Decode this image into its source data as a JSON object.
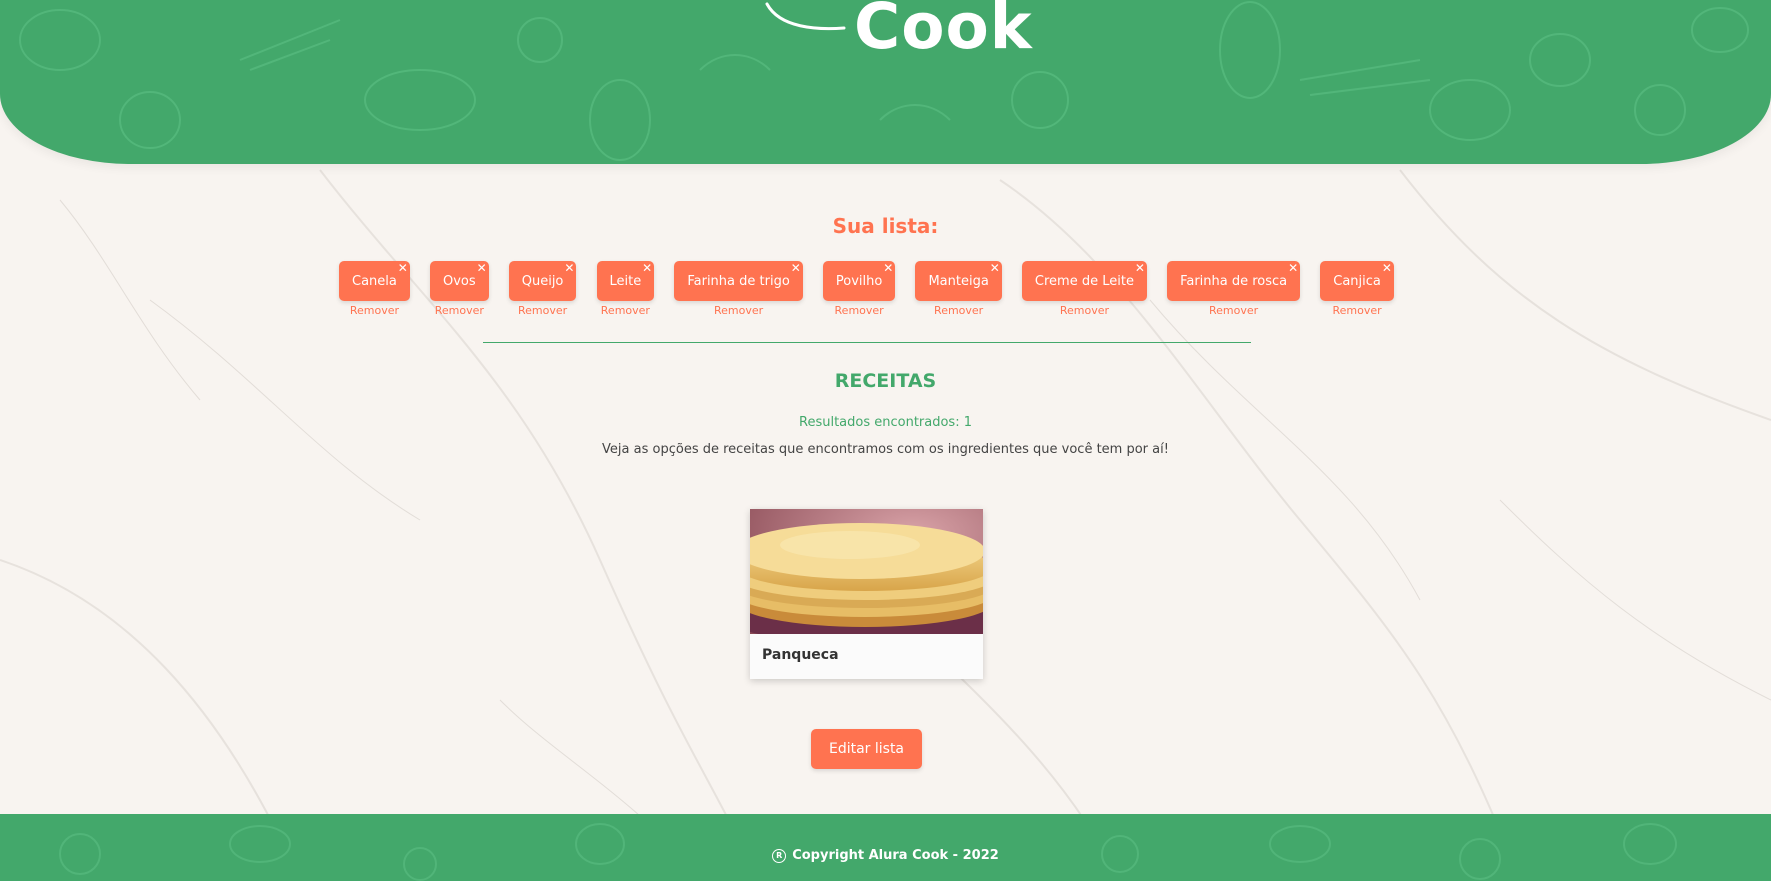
{
  "header": {
    "logo_text": "Cook"
  },
  "ingredients": {
    "title": "Sua lista:",
    "remove_label": "Remover",
    "items": [
      {
        "label": "Canela"
      },
      {
        "label": "Ovos"
      },
      {
        "label": "Queijo"
      },
      {
        "label": "Leite"
      },
      {
        "label": "Farinha de trigo"
      },
      {
        "label": "Povilho"
      },
      {
        "label": "Manteiga"
      },
      {
        "label": "Creme de Leite"
      },
      {
        "label": "Farinha de rosca"
      },
      {
        "label": "Canjica"
      }
    ],
    "close_glyph": "✕"
  },
  "recipes": {
    "title": "RECEITAS",
    "results": "Resultados encontrados: 1",
    "description": "Veja as opções de receitas que encontramos com os ingredientes que você tem por aí!",
    "cards": [
      {
        "title": "Panqueca",
        "image": "pancake-stack-photo"
      }
    ]
  },
  "actions": {
    "edit_label": "Editar lista"
  },
  "footer": {
    "reg_symbol": "R",
    "copyright": "Copyright Alura Cook - 2022"
  },
  "colors": {
    "green": "#43a86b",
    "orange": "#ff7350",
    "background": "#f8f4f0"
  }
}
